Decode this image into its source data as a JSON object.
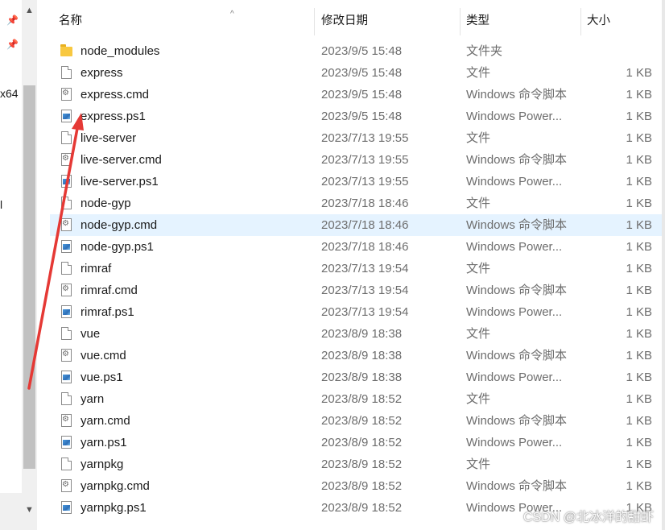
{
  "nav": {
    "fragments": [
      "x64",
      "l"
    ]
  },
  "header": {
    "name": "名称",
    "date": "修改日期",
    "type": "类型",
    "size": "大小"
  },
  "files": [
    {
      "name": "node_modules",
      "date": "2023/9/5 15:48",
      "type": "文件夹",
      "size": "",
      "icon": "folder-icon"
    },
    {
      "name": "express",
      "date": "2023/9/5 15:48",
      "type": "文件",
      "size": "1 KB",
      "icon": "file-icon"
    },
    {
      "name": "express.cmd",
      "date": "2023/9/5 15:48",
      "type": "Windows 命令脚本",
      "size": "1 KB",
      "icon": "cmd-script-icon"
    },
    {
      "name": "express.ps1",
      "date": "2023/9/5 15:48",
      "type": "Windows Power...",
      "size": "1 KB",
      "icon": "powershell-script-icon"
    },
    {
      "name": "live-server",
      "date": "2023/7/13 19:55",
      "type": "文件",
      "size": "1 KB",
      "icon": "file-icon"
    },
    {
      "name": "live-server.cmd",
      "date": "2023/7/13 19:55",
      "type": "Windows 命令脚本",
      "size": "1 KB",
      "icon": "cmd-script-icon"
    },
    {
      "name": "live-server.ps1",
      "date": "2023/7/13 19:55",
      "type": "Windows Power...",
      "size": "1 KB",
      "icon": "powershell-script-icon"
    },
    {
      "name": "node-gyp",
      "date": "2023/7/18 18:46",
      "type": "文件",
      "size": "1 KB",
      "icon": "file-icon"
    },
    {
      "name": "node-gyp.cmd",
      "date": "2023/7/18 18:46",
      "type": "Windows 命令脚本",
      "size": "1 KB",
      "icon": "cmd-script-icon",
      "selected": true
    },
    {
      "name": "node-gyp.ps1",
      "date": "2023/7/18 18:46",
      "type": "Windows Power...",
      "size": "1 KB",
      "icon": "powershell-script-icon"
    },
    {
      "name": "rimraf",
      "date": "2023/7/13 19:54",
      "type": "文件",
      "size": "1 KB",
      "icon": "file-icon"
    },
    {
      "name": "rimraf.cmd",
      "date": "2023/7/13 19:54",
      "type": "Windows 命令脚本",
      "size": "1 KB",
      "icon": "cmd-script-icon"
    },
    {
      "name": "rimraf.ps1",
      "date": "2023/7/13 19:54",
      "type": "Windows Power...",
      "size": "1 KB",
      "icon": "powershell-script-icon"
    },
    {
      "name": "vue",
      "date": "2023/8/9 18:38",
      "type": "文件",
      "size": "1 KB",
      "icon": "file-icon"
    },
    {
      "name": "vue.cmd",
      "date": "2023/8/9 18:38",
      "type": "Windows 命令脚本",
      "size": "1 KB",
      "icon": "cmd-script-icon"
    },
    {
      "name": "vue.ps1",
      "date": "2023/8/9 18:38",
      "type": "Windows Power...",
      "size": "1 KB",
      "icon": "powershell-script-icon"
    },
    {
      "name": "yarn",
      "date": "2023/8/9 18:52",
      "type": "文件",
      "size": "1 KB",
      "icon": "file-icon"
    },
    {
      "name": "yarn.cmd",
      "date": "2023/8/9 18:52",
      "type": "Windows 命令脚本",
      "size": "1 KB",
      "icon": "cmd-script-icon"
    },
    {
      "name": "yarn.ps1",
      "date": "2023/8/9 18:52",
      "type": "Windows Power...",
      "size": "1 KB",
      "icon": "powershell-script-icon"
    },
    {
      "name": "yarnpkg",
      "date": "2023/8/9 18:52",
      "type": "文件",
      "size": "1 KB",
      "icon": "file-icon"
    },
    {
      "name": "yarnpkg.cmd",
      "date": "2023/8/9 18:52",
      "type": "Windows 命令脚本",
      "size": "1 KB",
      "icon": "cmd-script-icon"
    },
    {
      "name": "yarnpkg.ps1",
      "date": "2023/8/9 18:52",
      "type": "Windows Power...",
      "size": "1 KB",
      "icon": "powershell-script-icon"
    }
  ],
  "annotation": {
    "color": "#e53935"
  },
  "watermark": "CSDN @北冰洋的甜虾"
}
